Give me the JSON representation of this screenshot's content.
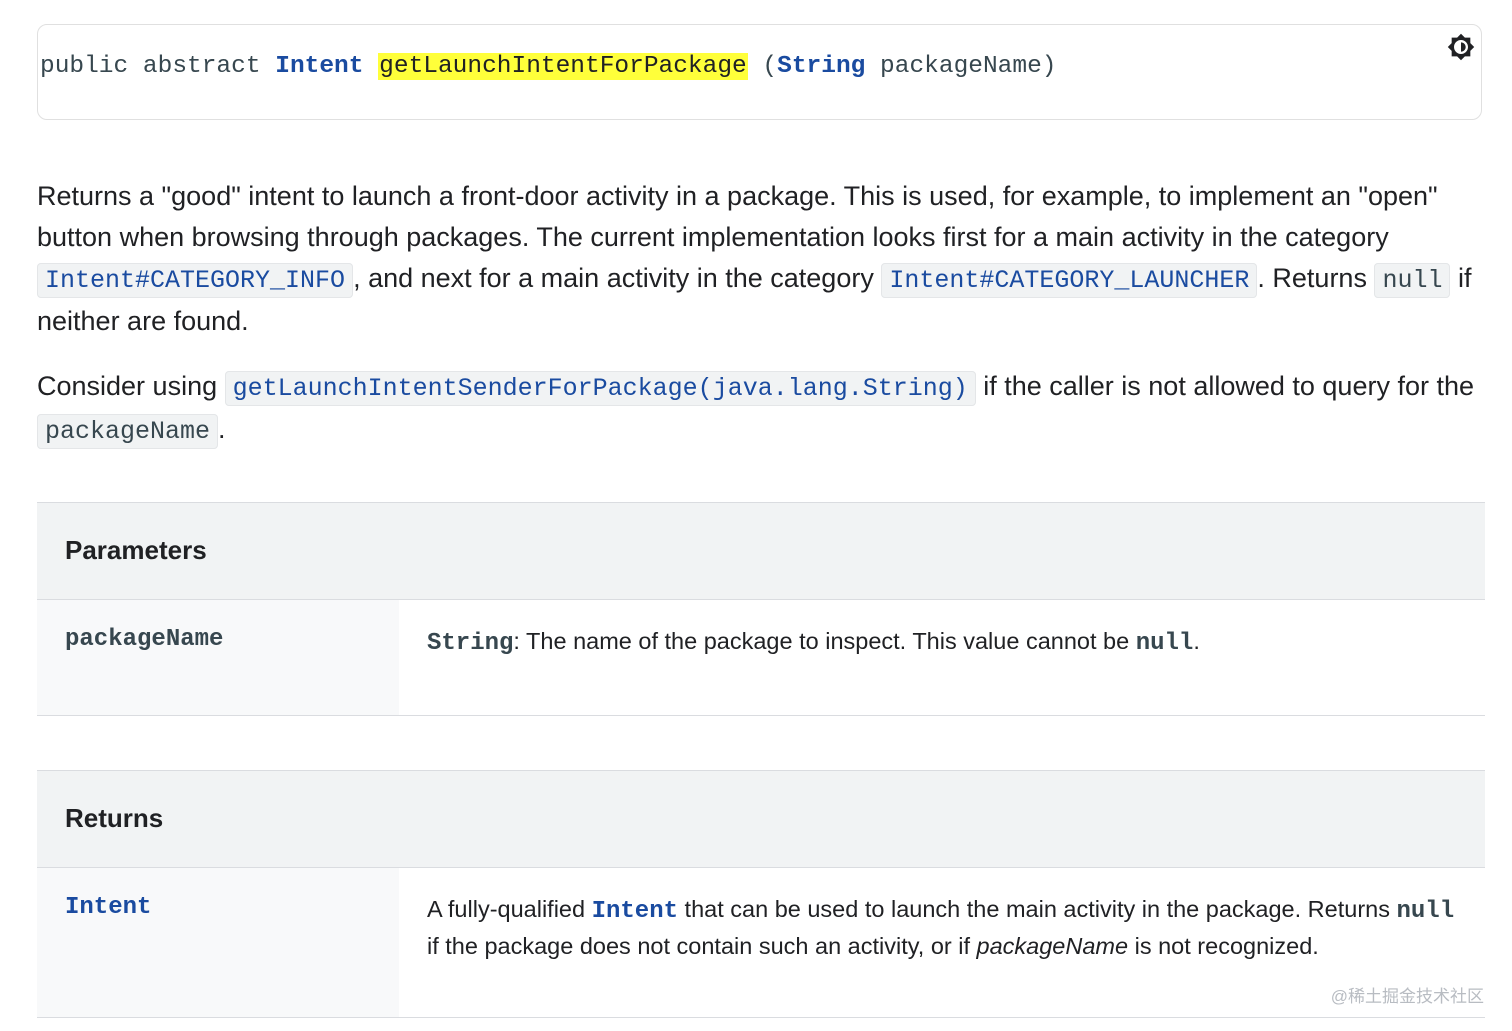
{
  "signature": {
    "modifiers": "public abstract ",
    "return_type": "Intent",
    "method_name": "getLaunchIntentForPackage",
    "open_paren": " (",
    "param_type": "String",
    "param_name": " packageName)"
  },
  "theme_toggle": {
    "icon": "brightness-icon"
  },
  "description": {
    "p1_part1": "Returns a \"good\" intent to launch a front-door activity in a package. This is used, for example, to implement an \"open\" button when browsing through packages. The current implementation looks first for a main activity in the category ",
    "p1_code1": "Intent#CATEGORY_INFO",
    "p1_part2": ", and next for a main activity in the category ",
    "p1_code2": "Intent#CATEGORY_LAUNCHER",
    "p1_part3": ". Returns ",
    "p1_code3": "null",
    "p1_part4": " if neither are found.",
    "p2_part1": "Consider using ",
    "p2_code1": "getLaunchIntentSenderForPackage(java.lang.String)",
    "p2_part2": " if the caller is not allowed to query for the ",
    "p2_code2": "packageName",
    "p2_part3": "."
  },
  "parameters": {
    "heading": "Parameters",
    "rows": [
      {
        "name": "packageName",
        "type": "String",
        "desc_part1": ": The name of the package to inspect. This value cannot be ",
        "desc_code": "null",
        "desc_part2": "."
      }
    ]
  },
  "returns": {
    "heading": "Returns",
    "rows": [
      {
        "name": "Intent",
        "desc_part1": "A fully-qualified ",
        "desc_code1": "Intent",
        "desc_part2": " that can be used to launch the main activity in the package. Returns ",
        "desc_code2": "null",
        "desc_part3": " if the package does not contain such an activity, or if ",
        "desc_ital": "packageName",
        "desc_part4": " is not recognized."
      }
    ]
  },
  "watermark": "@稀土掘金技术社区",
  "colors": {
    "link": "#1a4ba0",
    "highlight": "#ffff3a",
    "table_header_bg": "#f1f3f4",
    "name_cell_bg": "#f8f9fa",
    "border": "#dadce0"
  }
}
